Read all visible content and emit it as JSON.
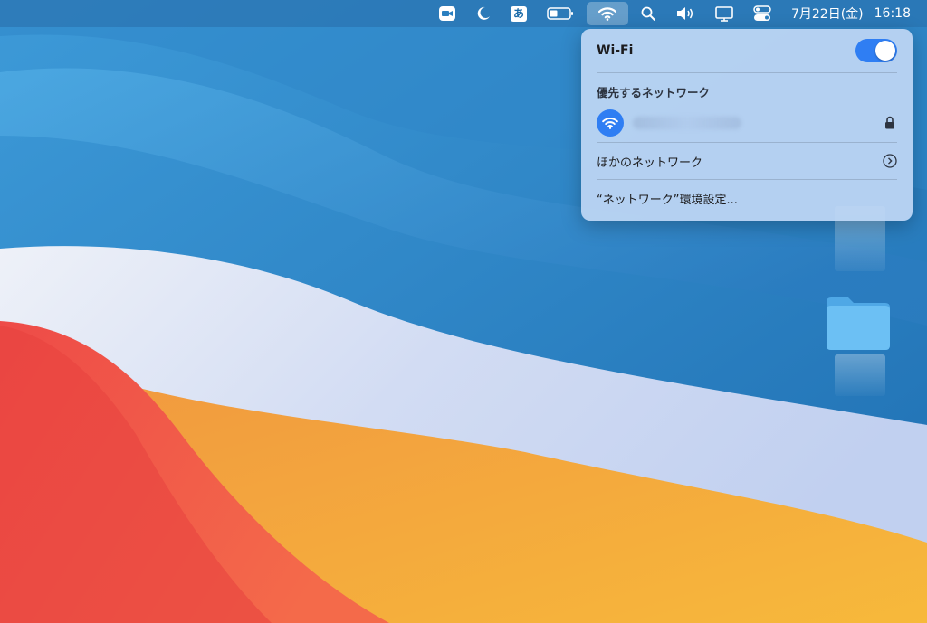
{
  "menubar": {
    "icons": [
      "zoom-app-icon",
      "moon-icon",
      "input-method-icon",
      "battery-icon",
      "wifi-icon",
      "search-icon",
      "volume-icon",
      "display-icon",
      "control-center-icon"
    ],
    "ime_label": "あ",
    "date": "7月22日(金)",
    "time": "16:18"
  },
  "wifi_menu": {
    "title": "Wi-Fi",
    "toggle_on": true,
    "preferred_section": "優先するネットワーク",
    "preferred_network_icon": "wifi-icon",
    "lock_icon": "lock-icon",
    "other_networks": "ほかのネットワーク",
    "network_prefs": "“ネットワーク”環境設定..."
  },
  "colors": {
    "accent": "#2f7ef3",
    "menu_bg": "#bed6f4"
  }
}
